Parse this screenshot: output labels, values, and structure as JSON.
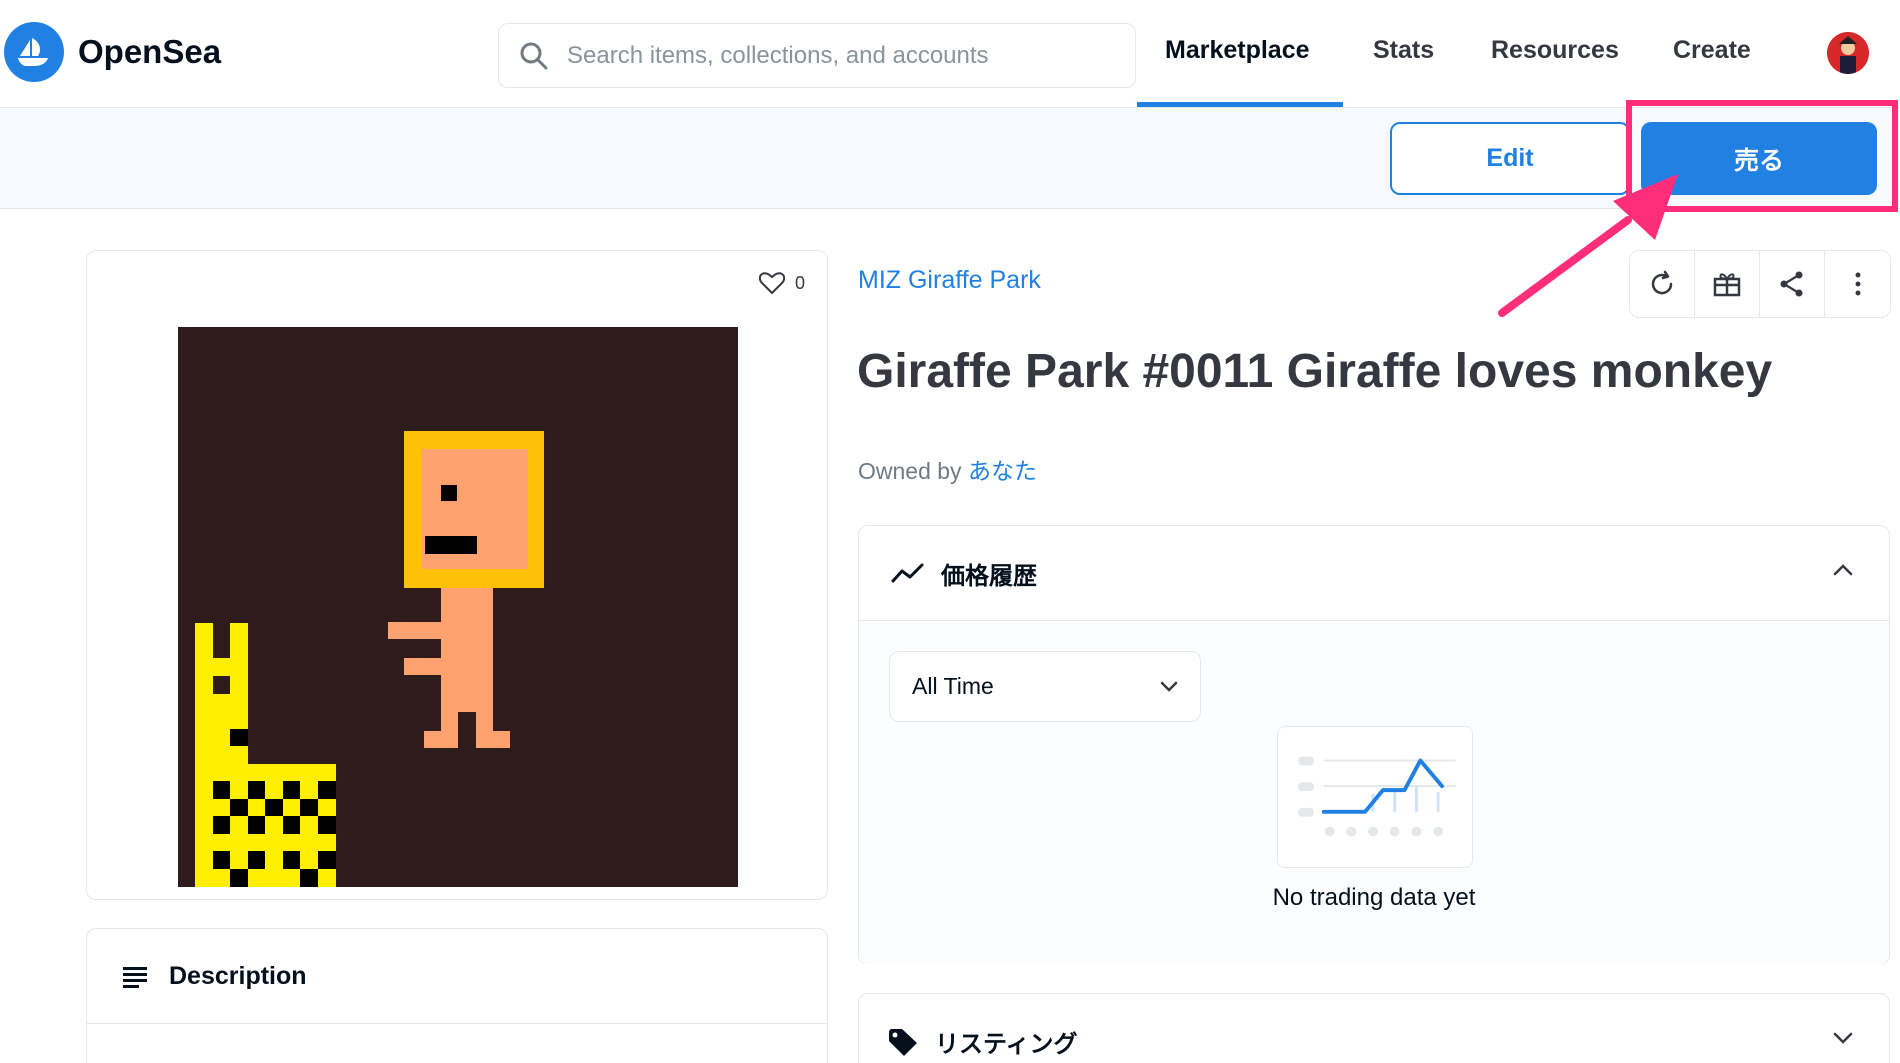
{
  "header": {
    "brand": "OpenSea",
    "search": {
      "placeholder": "Search items, collections, and accounts"
    },
    "nav": [
      {
        "label": "Marketplace",
        "active": true
      },
      {
        "label": "Stats"
      },
      {
        "label": "Resources"
      },
      {
        "label": "Create"
      }
    ]
  },
  "actions": {
    "edit_label": "Edit",
    "sell_label": "売る"
  },
  "item": {
    "favorites_count": "0",
    "collection": "MIZ Giraffe Park",
    "title": "Giraffe Park #0011 Giraffe loves monkey",
    "owned_by_prefix": "Owned by",
    "owner": "あなた"
  },
  "price_history": {
    "title": "価格履歴",
    "range": "All Time",
    "empty_text": "No trading data yet"
  },
  "listing": {
    "title": "リスティング"
  },
  "description": {
    "title": "Description"
  },
  "colors": {
    "accent": "#2081e2",
    "highlight": "#ff2d7a",
    "art_background": "#2e1c1c",
    "giraffe": "#ffee00",
    "monkey_body": "#ffa270",
    "monkey_frame": "#ffc107"
  },
  "icons": [
    "opensea-logo-icon",
    "search-icon",
    "heart-icon",
    "refresh-icon",
    "gift-icon",
    "share-icon",
    "more-icon",
    "trend-icon",
    "chevron-up-icon",
    "chevron-down-icon",
    "tag-icon",
    "list-icon"
  ]
}
